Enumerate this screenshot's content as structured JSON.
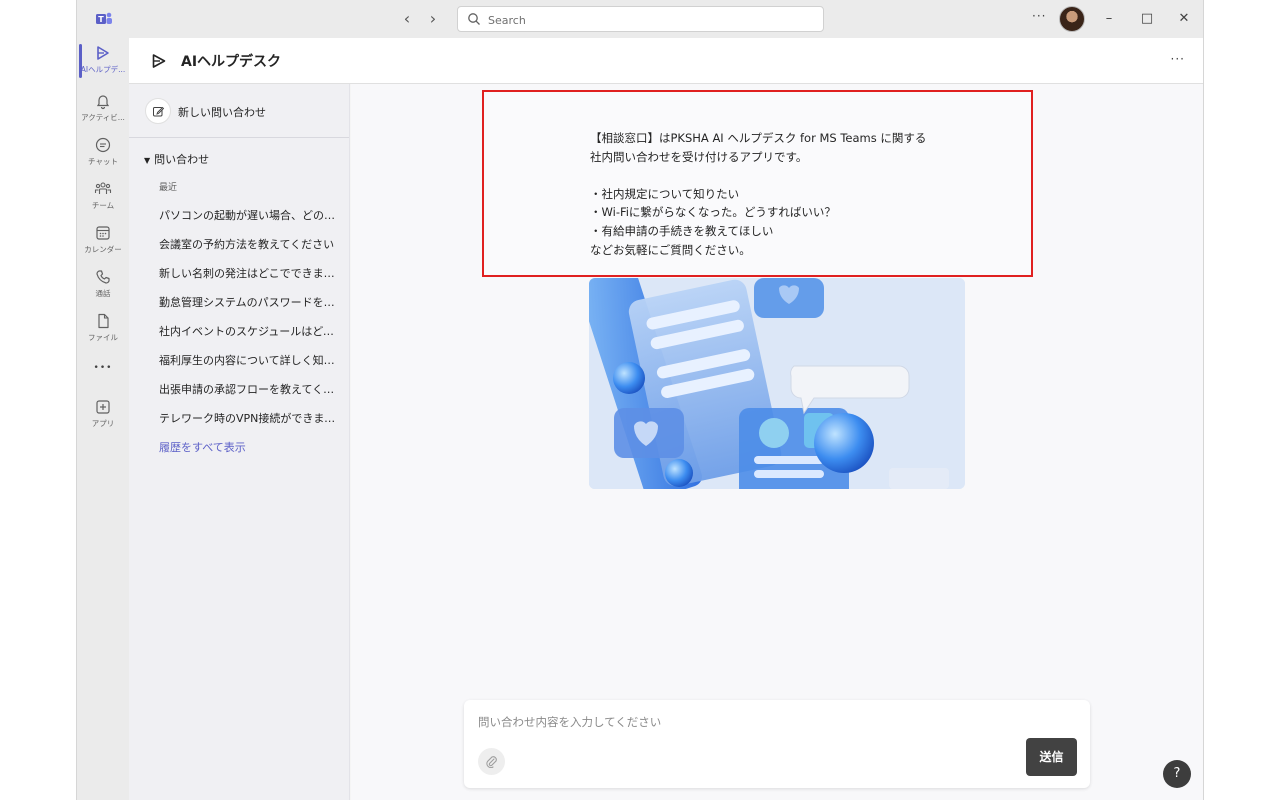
{
  "titlebar": {
    "search_placeholder": "Search",
    "more": "···",
    "minimize": "–",
    "maximize": "□",
    "close": "✕",
    "back": "‹",
    "forward": "›"
  },
  "rail": {
    "items": [
      {
        "label": "AIヘルプデ...",
        "icon": "play-icon"
      },
      {
        "label": "アクティビ...",
        "icon": "bell-icon"
      },
      {
        "label": "チャット",
        "icon": "chat-icon"
      },
      {
        "label": "チーム",
        "icon": "teams-icon"
      },
      {
        "label": "カレンダー",
        "icon": "calendar-icon"
      },
      {
        "label": "通話",
        "icon": "phone-icon"
      },
      {
        "label": "ファイル",
        "icon": "file-icon"
      },
      {
        "label": "",
        "icon": "more-icon"
      },
      {
        "label": "アプリ",
        "icon": "add-app-icon"
      }
    ],
    "more_glyph": "•••"
  },
  "header": {
    "title": "AIヘルプデスク",
    "more": "···"
  },
  "sidebar": {
    "new_inquiry": "新しい問い合わせ",
    "section_title": "問い合わせ",
    "section_caret": "▼",
    "recent_label": "最近",
    "history": [
      "パソコンの起動が遅い場合、どのようにすればよいですか？",
      "会議室の予約方法を教えてください",
      "新しい名刺の発注はどこでできますか？",
      "勤怠管理システムのパスワードを忘れました",
      "社内イベントのスケジュールはどこで確認できますか？",
      "福利厚生の内容について詳しく知りたい",
      "出張申請の承認フローを教えてください",
      "テレワーク時のVPN接続ができません"
    ],
    "show_all": "履歴をすべて表示"
  },
  "main": {
    "welcome_lines": [
      "【相談窓口】はPKSHA AI ヘルプデスク for MS Teams に関する",
      "社内問い合わせを受け付けるアプリです。",
      "",
      "・社内規定について知りたい",
      "・Wi-Fiに繋がらなくなった。どうすればいい？",
      "・有給申請の手続きを教えてほしい",
      "などお気軽にご質問ください。"
    ],
    "welcome_text": "【相談窓口】はPKSHA AI ヘルプデスク for MS Teams に関する\n社内問い合わせを受け付けるアプリです。\n\n・社内規定について知りたい\n・Wi-Fiに繋がらなくなった。どうすればいい？\n・有給申請の手続きを教えてほしい\nなどお気軽にご質問ください。"
  },
  "composer": {
    "placeholder": "問い合わせ内容を入力してください",
    "send_label": "送信"
  },
  "help": "?",
  "colors": {
    "accent": "#5b5fc7",
    "highlight_border": "#e02020",
    "send_button": "#424242"
  }
}
